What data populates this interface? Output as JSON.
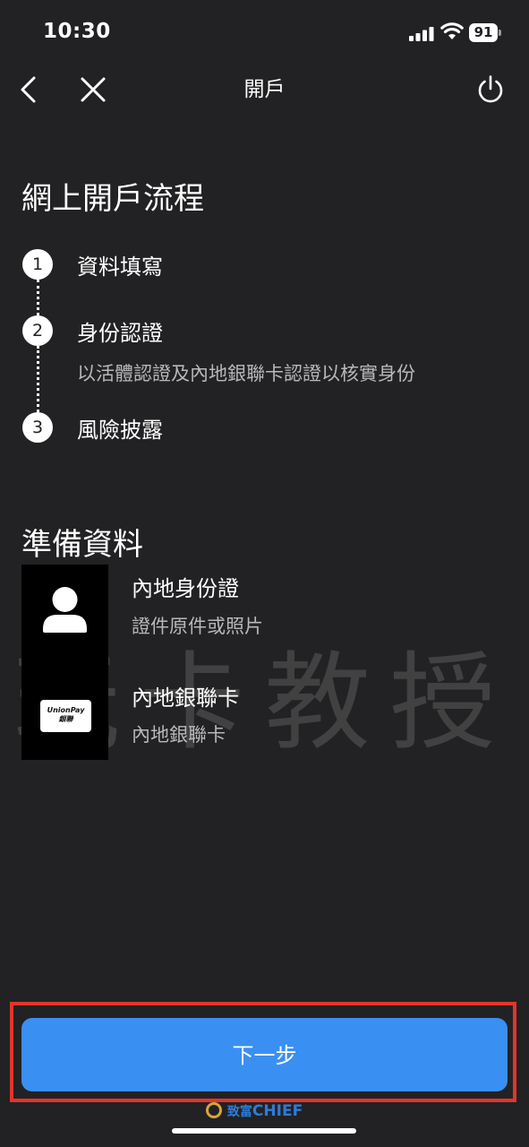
{
  "status_bar": {
    "time": "10:30",
    "battery": "91",
    "icons": [
      "signal-icon",
      "wifi-icon",
      "battery-icon"
    ]
  },
  "nav": {
    "title": "開戶",
    "icons": [
      "back-icon",
      "close-icon",
      "power-icon"
    ]
  },
  "steps_section": {
    "title": "網上開戶流程",
    "steps": [
      {
        "number": "1",
        "label": "資料填寫"
      },
      {
        "number": "2",
        "label": "身份認證",
        "description": "以活體認證及內地銀聯卡認證以核實身份"
      },
      {
        "number": "3",
        "label": "風險披露"
      }
    ]
  },
  "prep_section": {
    "title": "準備資料",
    "items": [
      {
        "icon": "person-id-icon",
        "title": "內地身份證",
        "subtitle": "證件原件或照片"
      },
      {
        "icon": "unionpay-card-icon",
        "card_text_1": "UnionPay",
        "card_text_2": "銀聯",
        "title": "內地銀聯卡",
        "subtitle": "內地銀聯卡"
      }
    ]
  },
  "watermark": "玩卡教授",
  "brand_watermark": {
    "prefix": "致富",
    "name": "CHIEF"
  },
  "next_button": {
    "label": "下一步"
  },
  "colors": {
    "background": "#222224",
    "button": "#3a8ff2",
    "highlight": "#e0362b"
  }
}
